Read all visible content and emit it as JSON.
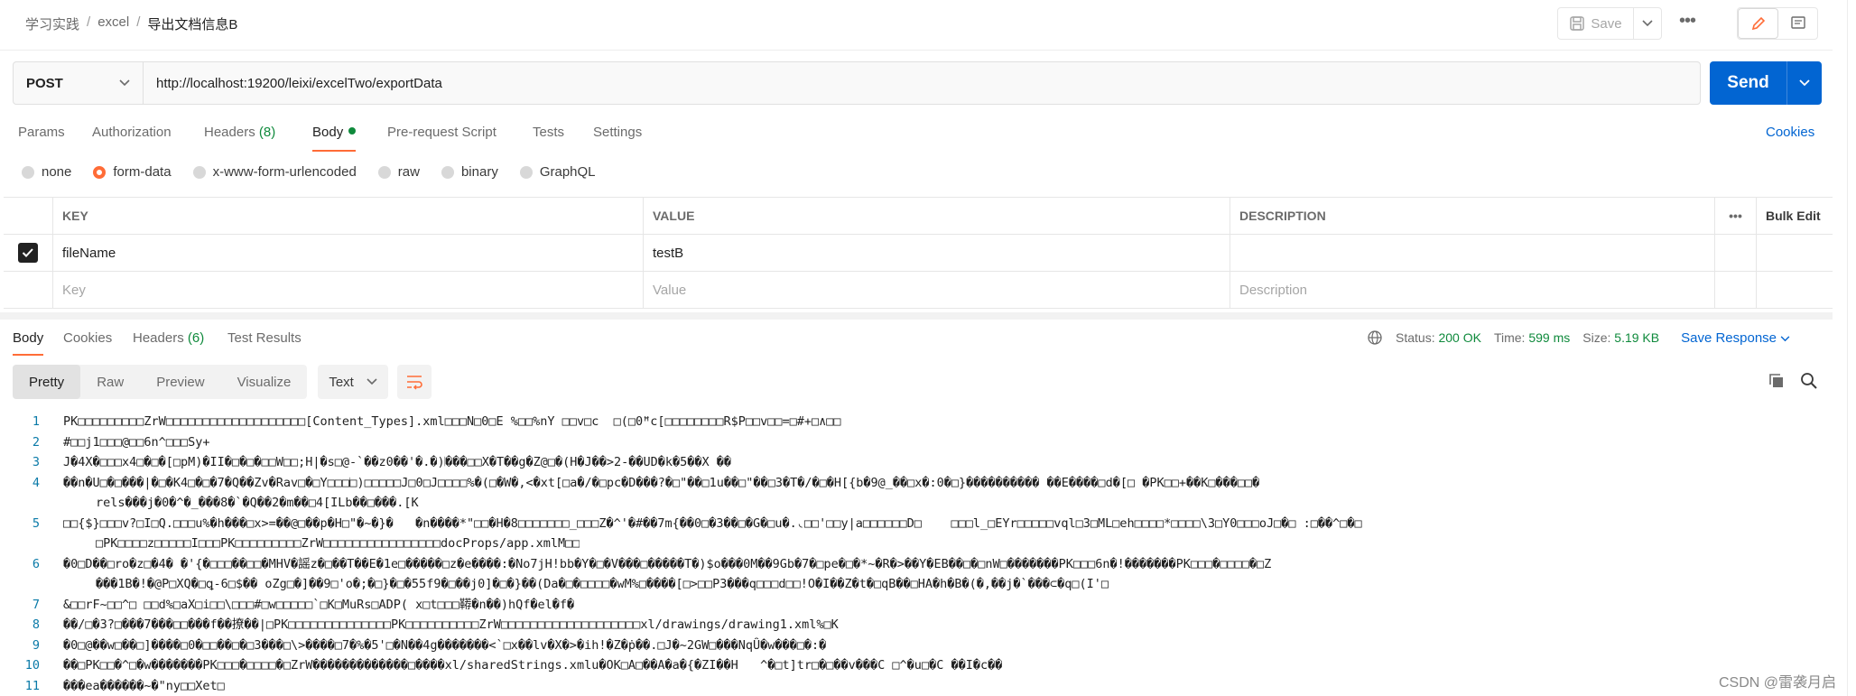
{
  "breadcrumb": [
    "学习实践",
    "excel",
    "导出文档信息B"
  ],
  "header": {
    "save_label": "Save",
    "more": "•••"
  },
  "request": {
    "method": "POST",
    "url": "http://localhost:19200/leixi/excelTwo/exportData",
    "send_label": "Send"
  },
  "request_tabs": {
    "params": "Params",
    "authorization": "Authorization",
    "headers": "Headers",
    "headers_count": "(8)",
    "body": "Body",
    "pre_request": "Pre-request Script",
    "tests": "Tests",
    "settings": "Settings",
    "cookies": "Cookies"
  },
  "body_types": {
    "none": "none",
    "form_data": "form-data",
    "urlencoded": "x-www-form-urlencoded",
    "raw": "raw",
    "binary": "binary",
    "graphql": "GraphQL",
    "selected": "form-data"
  },
  "form_table": {
    "headers": {
      "key": "KEY",
      "value": "VALUE",
      "description": "DESCRIPTION",
      "more": "•••",
      "bulk_edit": "Bulk Edit"
    },
    "rows": [
      {
        "key": "fileName",
        "value": "testB",
        "description": "",
        "checked": true
      }
    ],
    "placeholders": {
      "key": "Key",
      "value": "Value",
      "description": "Description"
    }
  },
  "response": {
    "tabs": {
      "body": "Body",
      "cookies": "Cookies",
      "headers": "Headers",
      "headers_count": "(6)",
      "test_results": "Test Results"
    },
    "status_label": "Status:",
    "status": "200 OK",
    "time_label": "Time:",
    "time": "599 ms",
    "size_label": "Size:",
    "size": "5.19 KB",
    "save_response": "Save Response",
    "views": {
      "pretty": "Pretty",
      "raw": "Raw",
      "preview": "Preview",
      "visualize": "Visualize"
    },
    "format": "Text"
  },
  "code_lines": [
    {
      "n": "1",
      "t": "PK□□□□□□□□□ZrW□□□□□□□□□□□□□□□□□□□[Content_Types].xml□□□N□0□E %□□%nY □□v□c  □(□0ꟸc[□□□□□□□□R$P□□v□□=□#+□∧□□"
    },
    {
      "n": "2",
      "t": "#□□j1□□□@□□6n^□□□Sy+"
    },
    {
      "n": "3",
      "t": "J�4X�□□□x4□�□�[□pM)�II�□�□�□□W□□;H|�s□@-`��z0��'�.�)𝄀���□□X�T��g�Z@□�(H�J��>2-��UD�k�5��X ��"
    },
    {
      "n": "4",
      "t": "��n�U□�□���|�□�K4□�□�7�Q��Zv�Rav□�□Y□□□𝄀□)□□□□□J□0□J□□□□%�(□�W�,<�xt[□a�/�□pc�D���?�□\"��□1u��□\"��□3�T�/�□�H[{b�9@_��□x�:0�□}���������� ��E����□d�[□ �PK□□+��K□���□□�",
      "t2": "rels���j�0�^�_���8�`�Q��2�m��□4[ILb��□���.[K"
    },
    {
      "n": "5",
      "t": "□□{$}□□□v?□I□Q.□□□u%�h���□x>=��@□��p�H□\"�~�}�   �n����*\"□□�H�8□□□□□□□_□□□Z�^'�#��7m{��0□�3��□�G�□u�.◟□□'□□y|a□□□□□□D□    □□□l_□EYr□□□□□vql□3□ML□eh□□□□*□□□□\\3□Y0□□□oJ□�□ :□��^□�□",
      "t2": "□PK□□□□z□□□□□I□□□PK□□□□□□□□□ZrW□□□□□□□□□□□□□□□□docProps/app.xmlM□□"
    },
    {
      "n": "6",
      "t": "�0□D��□ro�z□�4� �'{�□□□��□□�MHV�謡z�□��T��E�1e□�����□z�e����:�No7jH!bb�Y�□�V���□�����T�)$o���0M��9Gb�7�□pe�□�*~�R�>��Y�EB��□�□nW□�������PK□□□6n�!�������PK□□□�□□□□�□Z",
      "t2": "���1B�!�@P□XQ�□ꝗ-6□$�� oZg□�]��9□'o�;�□}�□�55f9�□��j0]�□�}��(Da�□�□□□□�wM%□����[□>□□P3���q□□□d□□!O�I��Z�t�□qB��□HA�h�B�(�,��j�`���⊂�q□(I'□"
    },
    {
      "n": "7",
      "t": "&□□rF~□□^□ □□d%□aX□i□□\\□□□#□w□□□□□`□K□MuRs□ADP( x□t□□□鞯�n��)hQf�el�f�"
    },
    {
      "n": "8",
      "t": "��/□�3?□���7���□□���f��撩��|□PK□□□□□□□□□□□□□□PK□□□□□□□□□□ZrW□□□□□□□□□□□□□□□□□□□xl/drawings/drawing1.xml%□K"
    },
    {
      "n": "9",
      "t": "�0□@��w□��□]����□0�□□��□�□3���□\\>����□7�%�5'□�N��4g�������<`□x��lv�X�>�ih!�Z�ṗ��.□J�~2GW□���NqȖ�w���□�:�"
    },
    {
      "n": "10",
      "t": "��□PK□□�^□�w�������PK□□□�□□□□�□ZrW�������������□����xl/sharedStrings.xmlu�OK□A□��A�a�{�ZI��H   ^�□t]tr□�□��v���C □^�u□�C ��I�c��"
    },
    {
      "n": "11",
      "t": "���ea������~�\"ny□□Xet□"
    }
  ],
  "watermark": "CSDN @雷袭月启"
}
